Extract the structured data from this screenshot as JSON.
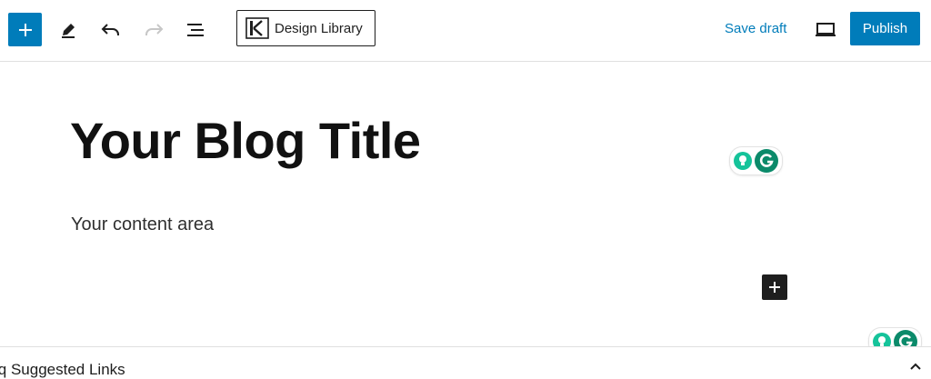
{
  "toolbar": {
    "design_library_label": "Design Library",
    "save_draft_label": "Save draft",
    "publish_label": "Publish",
    "icons": {
      "add": "plus-icon",
      "tools": "pencil-icon",
      "undo": "undo-icon",
      "redo": "redo-icon",
      "outline": "list-view-icon",
      "design_library": "design-library-logo-icon",
      "preview": "laptop-preview-icon"
    }
  },
  "editor": {
    "title": "Your Blog Title",
    "paragraph": "Your content area"
  },
  "bottom_panel": {
    "label": "iq Suggested Links"
  },
  "colors": {
    "accent": "#007cba",
    "grammarly_green": "#15c39a",
    "grammarly_dark": "#0b8a6a",
    "inserter_bg": "#1e1e1e"
  }
}
